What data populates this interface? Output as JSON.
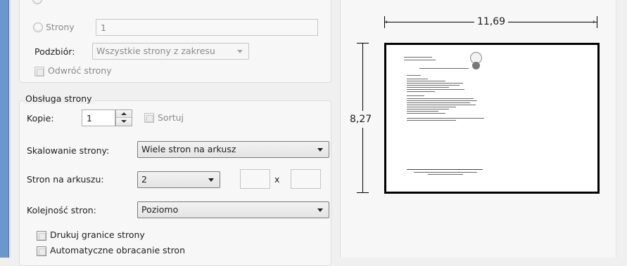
{
  "range": {
    "pages_radio_label": "Strony",
    "pages_value": "1",
    "subset_label": "Podzbiór:",
    "subset_value": "Wszystkie strony z zakresu",
    "reverse_label": "Odwróć strony"
  },
  "page_handling": {
    "title": "Obsługa strony",
    "copies_label": "Kopie:",
    "copies_value": "1",
    "collate_label": "Sortuj",
    "scaling_label": "Skalowanie strony:",
    "scaling_value": "Wiele stron na arkusz",
    "pages_per_sheet_label": "Stron na arkuszu:",
    "pages_per_sheet_value": "2",
    "x_label": "x",
    "order_label": "Kolejność stron:",
    "order_value": "Poziomo",
    "print_borders_label": "Drukuj granice strony",
    "auto_rotate_label": "Automatyczne obracanie stron"
  },
  "preview": {
    "width": "11,69",
    "height": "8,27"
  }
}
